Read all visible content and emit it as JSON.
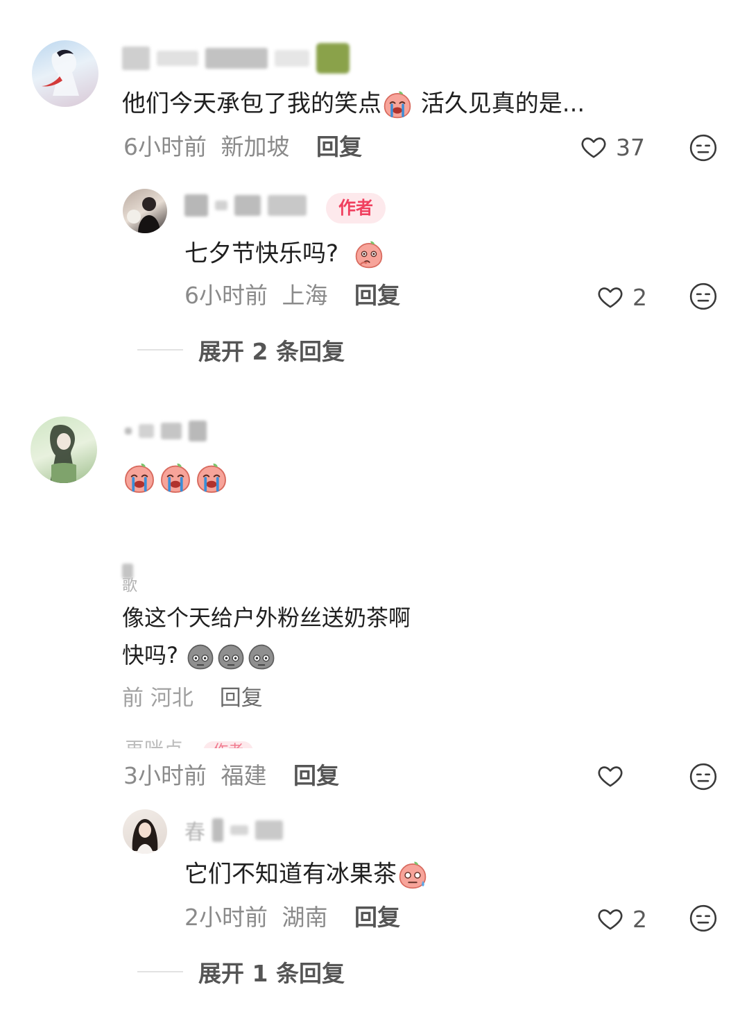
{
  "comments": [
    {
      "text": "他们今天承包了我的笑点",
      "text_suffix": " 活久见真的是...",
      "time": "6小时前",
      "location": "新加坡",
      "reply_label": "回复",
      "likes": "37",
      "replies": [
        {
          "author_tag": "作者",
          "text": "七夕节快乐吗?",
          "time": "6小时前",
          "location": "上海",
          "reply_label": "回复",
          "likes": "2"
        }
      ],
      "expand_label": "展开 2 条回复"
    },
    {
      "text": "",
      "emoji_count": "3"
    },
    {
      "name_partial": "歌",
      "text_line1": "像这个天给户外粉丝送奶茶啊",
      "text_line2": "快吗?",
      "meta_partial": "前 河北",
      "reply_label": "回复",
      "overlay_name_partial": "再咪点",
      "overlay_tag": "作者",
      "time": "3小时前",
      "location": "福建",
      "reply_label2": "回复",
      "replies": [
        {
          "name_partial": "春",
          "text": "它们不知道有冰果茶",
          "time": "2小时前",
          "location": "湖南",
          "reply_label": "回复",
          "likes": "2"
        }
      ],
      "expand_label": "展开 1 条回复"
    }
  ],
  "colors": {
    "author_tag_bg": "#fde9ec",
    "author_tag_text": "#f0405f",
    "meta_text": "#8a8a8a"
  }
}
